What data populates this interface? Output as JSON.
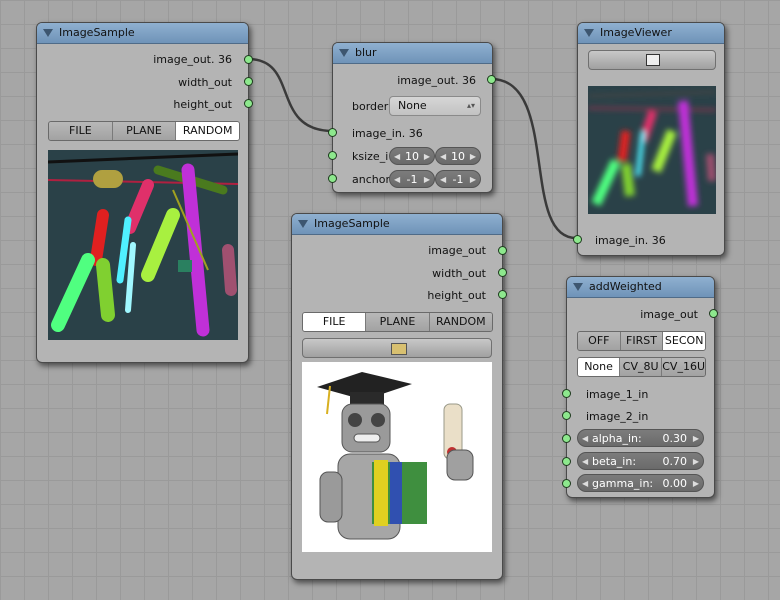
{
  "nodes": {
    "sample1": {
      "title": "ImageSample",
      "outputs": [
        "image_out. 36",
        "width_out",
        "height_out"
      ],
      "modes": [
        "FILE",
        "PLANE",
        "RANDOM"
      ],
      "active_mode": "RANDOM"
    },
    "blur": {
      "title": "blur",
      "output": "image_out. 36",
      "border_label": "border",
      "border_value": "None",
      "input": "image_in. 36",
      "ksize_label": "ksize_i",
      "ksize_values": [
        "10",
        "10"
      ],
      "anchor_label": "anchor",
      "anchor_values": [
        "-1",
        "-1"
      ]
    },
    "viewer": {
      "title": "ImageViewer",
      "input": "image_in. 36"
    },
    "sample2": {
      "title": "ImageSample",
      "outputs": [
        "image_out",
        "width_out",
        "height_out"
      ],
      "modes": [
        "FILE",
        "PLANE",
        "RANDOM"
      ],
      "active_mode": "FILE"
    },
    "weighted": {
      "title": "addWeighted",
      "output": "image_out",
      "modes1": [
        "OFF",
        "FIRST",
        "SECON"
      ],
      "active_mode1": "SECON",
      "modes2": [
        "None",
        "CV_8U",
        "CV_16U"
      ],
      "active_mode2": "None",
      "inputs": [
        "image_1_in",
        "image_2_in"
      ],
      "params": [
        {
          "label": "alpha_in:",
          "value": "0.30"
        },
        {
          "label": "beta_in:",
          "value": "0.70"
        },
        {
          "label": "gamma_in:",
          "value": "0.00"
        }
      ]
    }
  },
  "colors": {
    "socket": "#8de88d",
    "header": "#7fa1c4",
    "node_body": "#b4b4b4",
    "wire": "#3c3c3c"
  },
  "icons": {
    "collapse": "triangle-down-icon",
    "open_file": "folder-icon",
    "display": "monitor-icon"
  }
}
